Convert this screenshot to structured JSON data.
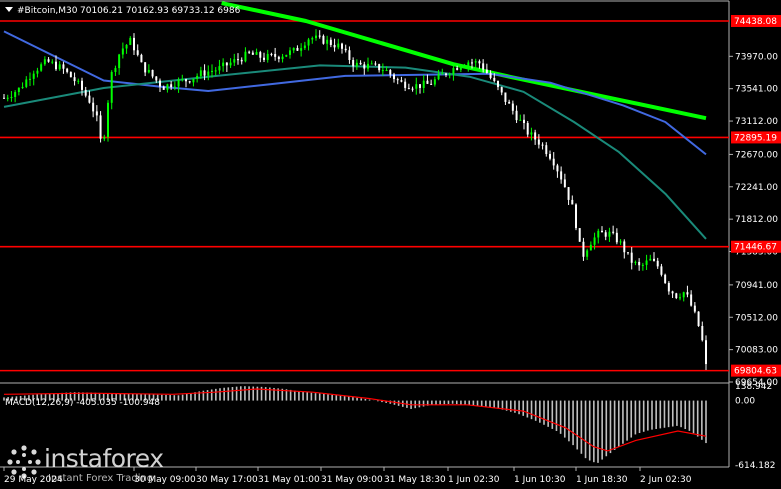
{
  "header": {
    "menu_icon": "triangle-down-icon",
    "symbol": "#Bitcoin,M30",
    "ohlc": "70106.21 70162.93 69733.12 6986"
  },
  "colors": {
    "background": "#000000",
    "bull_candle": "#00ff00",
    "bear_candle": "#ffffff",
    "level_line": "#ff0000",
    "ma_fast": "#1a8a7a",
    "ma_mid": "#4169e1",
    "ma_slow": "#00ff00",
    "macd_hist": "#c0c0c0",
    "macd_signal": "#ff0000"
  },
  "watermark": {
    "logo": "instaforex-logo-icon",
    "brand": "instaforex",
    "tagline": "Instant Forex Trading"
  },
  "chart_data": [
    {
      "type": "candlestick",
      "title": "#Bitcoin,M30",
      "y_ticks": [
        "73970.00",
        "73541.00",
        "73112.00",
        "72670.00",
        "72241.00",
        "71812.00",
        "71383.00",
        "70941.00",
        "70512.00",
        "70083.00",
        "69654.00"
      ],
      "ylim": [
        69654,
        74438
      ],
      "x_ticks": [
        "29 May 2024",
        "30 May 09:00",
        "30 May 17:00",
        "31 May 01:00",
        "31 May 09:00",
        "31 May 18:30",
        "1 Jun 02:30",
        "1 Jun 10:30",
        "1 Jun 18:30",
        "2 Jun 02:30"
      ],
      "levels": [
        {
          "value": 74438.08,
          "label": "74438.08"
        },
        {
          "value": 72895.19,
          "label": "72895.19"
        },
        {
          "value": 71446.67,
          "label": "71446.67"
        },
        {
          "value": 69804.63,
          "label": "69804.63"
        }
      ],
      "series": [
        {
          "kind": "ma",
          "color": "#00ff00",
          "values": [
            {
              "x": 0.31,
              "y": 74675
            },
            {
              "x": 0.43,
              "y": 74438
            },
            {
              "x": 0.64,
              "y": 73865
            },
            {
              "x": 0.72,
              "y": 73700
            },
            {
              "x": 1.0,
              "y": 73150
            }
          ]
        },
        {
          "kind": "ma",
          "color": "#4169e1",
          "values": [
            {
              "x": 0.0,
              "y": 74300
            },
            {
              "x": 0.142,
              "y": 73650
            },
            {
              "x": 0.22,
              "y": 73570
            },
            {
              "x": 0.291,
              "y": 73510
            },
            {
              "x": 0.379,
              "y": 73600
            },
            {
              "x": 0.486,
              "y": 73710
            },
            {
              "x": 0.692,
              "y": 73740
            },
            {
              "x": 0.778,
              "y": 73620
            },
            {
              "x": 0.882,
              "y": 73320
            },
            {
              "x": 0.942,
              "y": 73100
            },
            {
              "x": 1.0,
              "y": 72670
            }
          ]
        },
        {
          "kind": "ma",
          "color": "#1a8a7a",
          "values": [
            {
              "x": 0.0,
              "y": 73300
            },
            {
              "x": 0.142,
              "y": 73550
            },
            {
              "x": 0.291,
              "y": 73700
            },
            {
              "x": 0.45,
              "y": 73850
            },
            {
              "x": 0.572,
              "y": 73820
            },
            {
              "x": 0.663,
              "y": 73700
            },
            {
              "x": 0.74,
              "y": 73500
            },
            {
              "x": 0.812,
              "y": 73100
            },
            {
              "x": 0.876,
              "y": 72700
            },
            {
              "x": 0.942,
              "y": 72150
            },
            {
              "x": 1.0,
              "y": 71550
            }
          ]
        },
        {
          "kind": "price",
          "values": [
            {
              "x": 0.0,
              "y": 73420
            },
            {
              "x": 0.022,
              "y": 73540
            },
            {
              "x": 0.042,
              "y": 73780
            },
            {
              "x": 0.062,
              "y": 73900
            },
            {
              "x": 0.084,
              "y": 73800
            },
            {
              "x": 0.104,
              "y": 73620
            },
            {
              "x": 0.122,
              "y": 73380
            },
            {
              "x": 0.132,
              "y": 73150
            },
            {
              "x": 0.14,
              "y": 72720
            },
            {
              "x": 0.152,
              "y": 73700
            },
            {
              "x": 0.166,
              "y": 74050
            },
            {
              "x": 0.181,
              "y": 74180
            },
            {
              "x": 0.196,
              "y": 73850
            },
            {
              "x": 0.212,
              "y": 73700
            },
            {
              "x": 0.226,
              "y": 73560
            },
            {
              "x": 0.242,
              "y": 73620
            },
            {
              "x": 0.262,
              "y": 73660
            },
            {
              "x": 0.283,
              "y": 73750
            },
            {
              "x": 0.305,
              "y": 73800
            },
            {
              "x": 0.327,
              "y": 73900
            },
            {
              "x": 0.349,
              "y": 74000
            },
            {
              "x": 0.371,
              "y": 73950
            },
            {
              "x": 0.392,
              "y": 73980
            },
            {
              "x": 0.414,
              "y": 74040
            },
            {
              "x": 0.435,
              "y": 74220
            },
            {
              "x": 0.456,
              "y": 74180
            },
            {
              "x": 0.478,
              "y": 74100
            },
            {
              "x": 0.499,
              "y": 73860
            },
            {
              "x": 0.521,
              "y": 73840
            },
            {
              "x": 0.542,
              "y": 73800
            },
            {
              "x": 0.564,
              "y": 73620
            },
            {
              "x": 0.585,
              "y": 73580
            },
            {
              "x": 0.606,
              "y": 73600
            },
            {
              "x": 0.624,
              "y": 73720
            },
            {
              "x": 0.642,
              "y": 73820
            },
            {
              "x": 0.66,
              "y": 73900
            },
            {
              "x": 0.678,
              "y": 73880
            },
            {
              "x": 0.695,
              "y": 73660
            },
            {
              "x": 0.712,
              "y": 73420
            },
            {
              "x": 0.73,
              "y": 73180
            },
            {
              "x": 0.747,
              "y": 72950
            },
            {
              "x": 0.764,
              "y": 72820
            },
            {
              "x": 0.781,
              "y": 72620
            },
            {
              "x": 0.797,
              "y": 72300
            },
            {
              "x": 0.812,
              "y": 71900
            },
            {
              "x": 0.823,
              "y": 71300
            },
            {
              "x": 0.834,
              "y": 71500
            },
            {
              "x": 0.848,
              "y": 71620
            },
            {
              "x": 0.862,
              "y": 71620
            },
            {
              "x": 0.876,
              "y": 71520
            },
            {
              "x": 0.892,
              "y": 71270
            },
            {
              "x": 0.906,
              "y": 71170
            },
            {
              "x": 0.92,
              "y": 71270
            },
            {
              "x": 0.934,
              "y": 71170
            },
            {
              "x": 0.946,
              "y": 70900
            },
            {
              "x": 0.958,
              "y": 70800
            },
            {
              "x": 0.97,
              "y": 70850
            },
            {
              "x": 0.982,
              "y": 70600
            },
            {
              "x": 0.993,
              "y": 70300
            },
            {
              "x": 1.0,
              "y": 69860
            }
          ]
        }
      ]
    },
    {
      "type": "bar",
      "title": "MACD(12,26,9) -405.035 -100.948",
      "y_ticks": [
        "138.942",
        "0.00",
        "-614.182"
      ],
      "ylim": [
        -614.182,
        138.942
      ],
      "series": [
        {
          "name": "histogram",
          "values": [
            {
              "x": 0.0,
              "y": 30
            },
            {
              "x": 0.05,
              "y": 60
            },
            {
              "x": 0.1,
              "y": 80
            },
            {
              "x": 0.15,
              "y": 70
            },
            {
              "x": 0.2,
              "y": 60
            },
            {
              "x": 0.25,
              "y": 50
            },
            {
              "x": 0.28,
              "y": 90
            },
            {
              "x": 0.31,
              "y": 120
            },
            {
              "x": 0.34,
              "y": 138
            },
            {
              "x": 0.37,
              "y": 130
            },
            {
              "x": 0.4,
              "y": 110
            },
            {
              "x": 0.43,
              "y": 80
            },
            {
              "x": 0.46,
              "y": 60
            },
            {
              "x": 0.49,
              "y": 40
            },
            {
              "x": 0.52,
              "y": 10
            },
            {
              "x": 0.55,
              "y": -30
            },
            {
              "x": 0.58,
              "y": -80
            },
            {
              "x": 0.61,
              "y": -40
            },
            {
              "x": 0.64,
              "y": -30
            },
            {
              "x": 0.67,
              "y": -50
            },
            {
              "x": 0.7,
              "y": -70
            },
            {
              "x": 0.73,
              "y": -120
            },
            {
              "x": 0.76,
              "y": -200
            },
            {
              "x": 0.79,
              "y": -300
            },
            {
              "x": 0.81,
              "y": -420
            },
            {
              "x": 0.83,
              "y": -560
            },
            {
              "x": 0.845,
              "y": -600
            },
            {
              "x": 0.86,
              "y": -520
            },
            {
              "x": 0.88,
              "y": -420
            },
            {
              "x": 0.9,
              "y": -320
            },
            {
              "x": 0.92,
              "y": -280
            },
            {
              "x": 0.94,
              "y": -260
            },
            {
              "x": 0.96,
              "y": -240
            },
            {
              "x": 0.98,
              "y": -300
            },
            {
              "x": 1.0,
              "y": -405
            }
          ]
        },
        {
          "name": "signal",
          "values": [
            {
              "x": 0.0,
              "y": 60
            },
            {
              "x": 0.12,
              "y": 70
            },
            {
              "x": 0.24,
              "y": 60
            },
            {
              "x": 0.3,
              "y": 80
            },
            {
              "x": 0.36,
              "y": 110
            },
            {
              "x": 0.44,
              "y": 80
            },
            {
              "x": 0.52,
              "y": 20
            },
            {
              "x": 0.58,
              "y": -40
            },
            {
              "x": 0.66,
              "y": -40
            },
            {
              "x": 0.74,
              "y": -100
            },
            {
              "x": 0.8,
              "y": -260
            },
            {
              "x": 0.84,
              "y": -440
            },
            {
              "x": 0.86,
              "y": -480
            },
            {
              "x": 0.9,
              "y": -380
            },
            {
              "x": 0.96,
              "y": -290
            },
            {
              "x": 1.0,
              "y": -340
            }
          ]
        }
      ]
    }
  ]
}
